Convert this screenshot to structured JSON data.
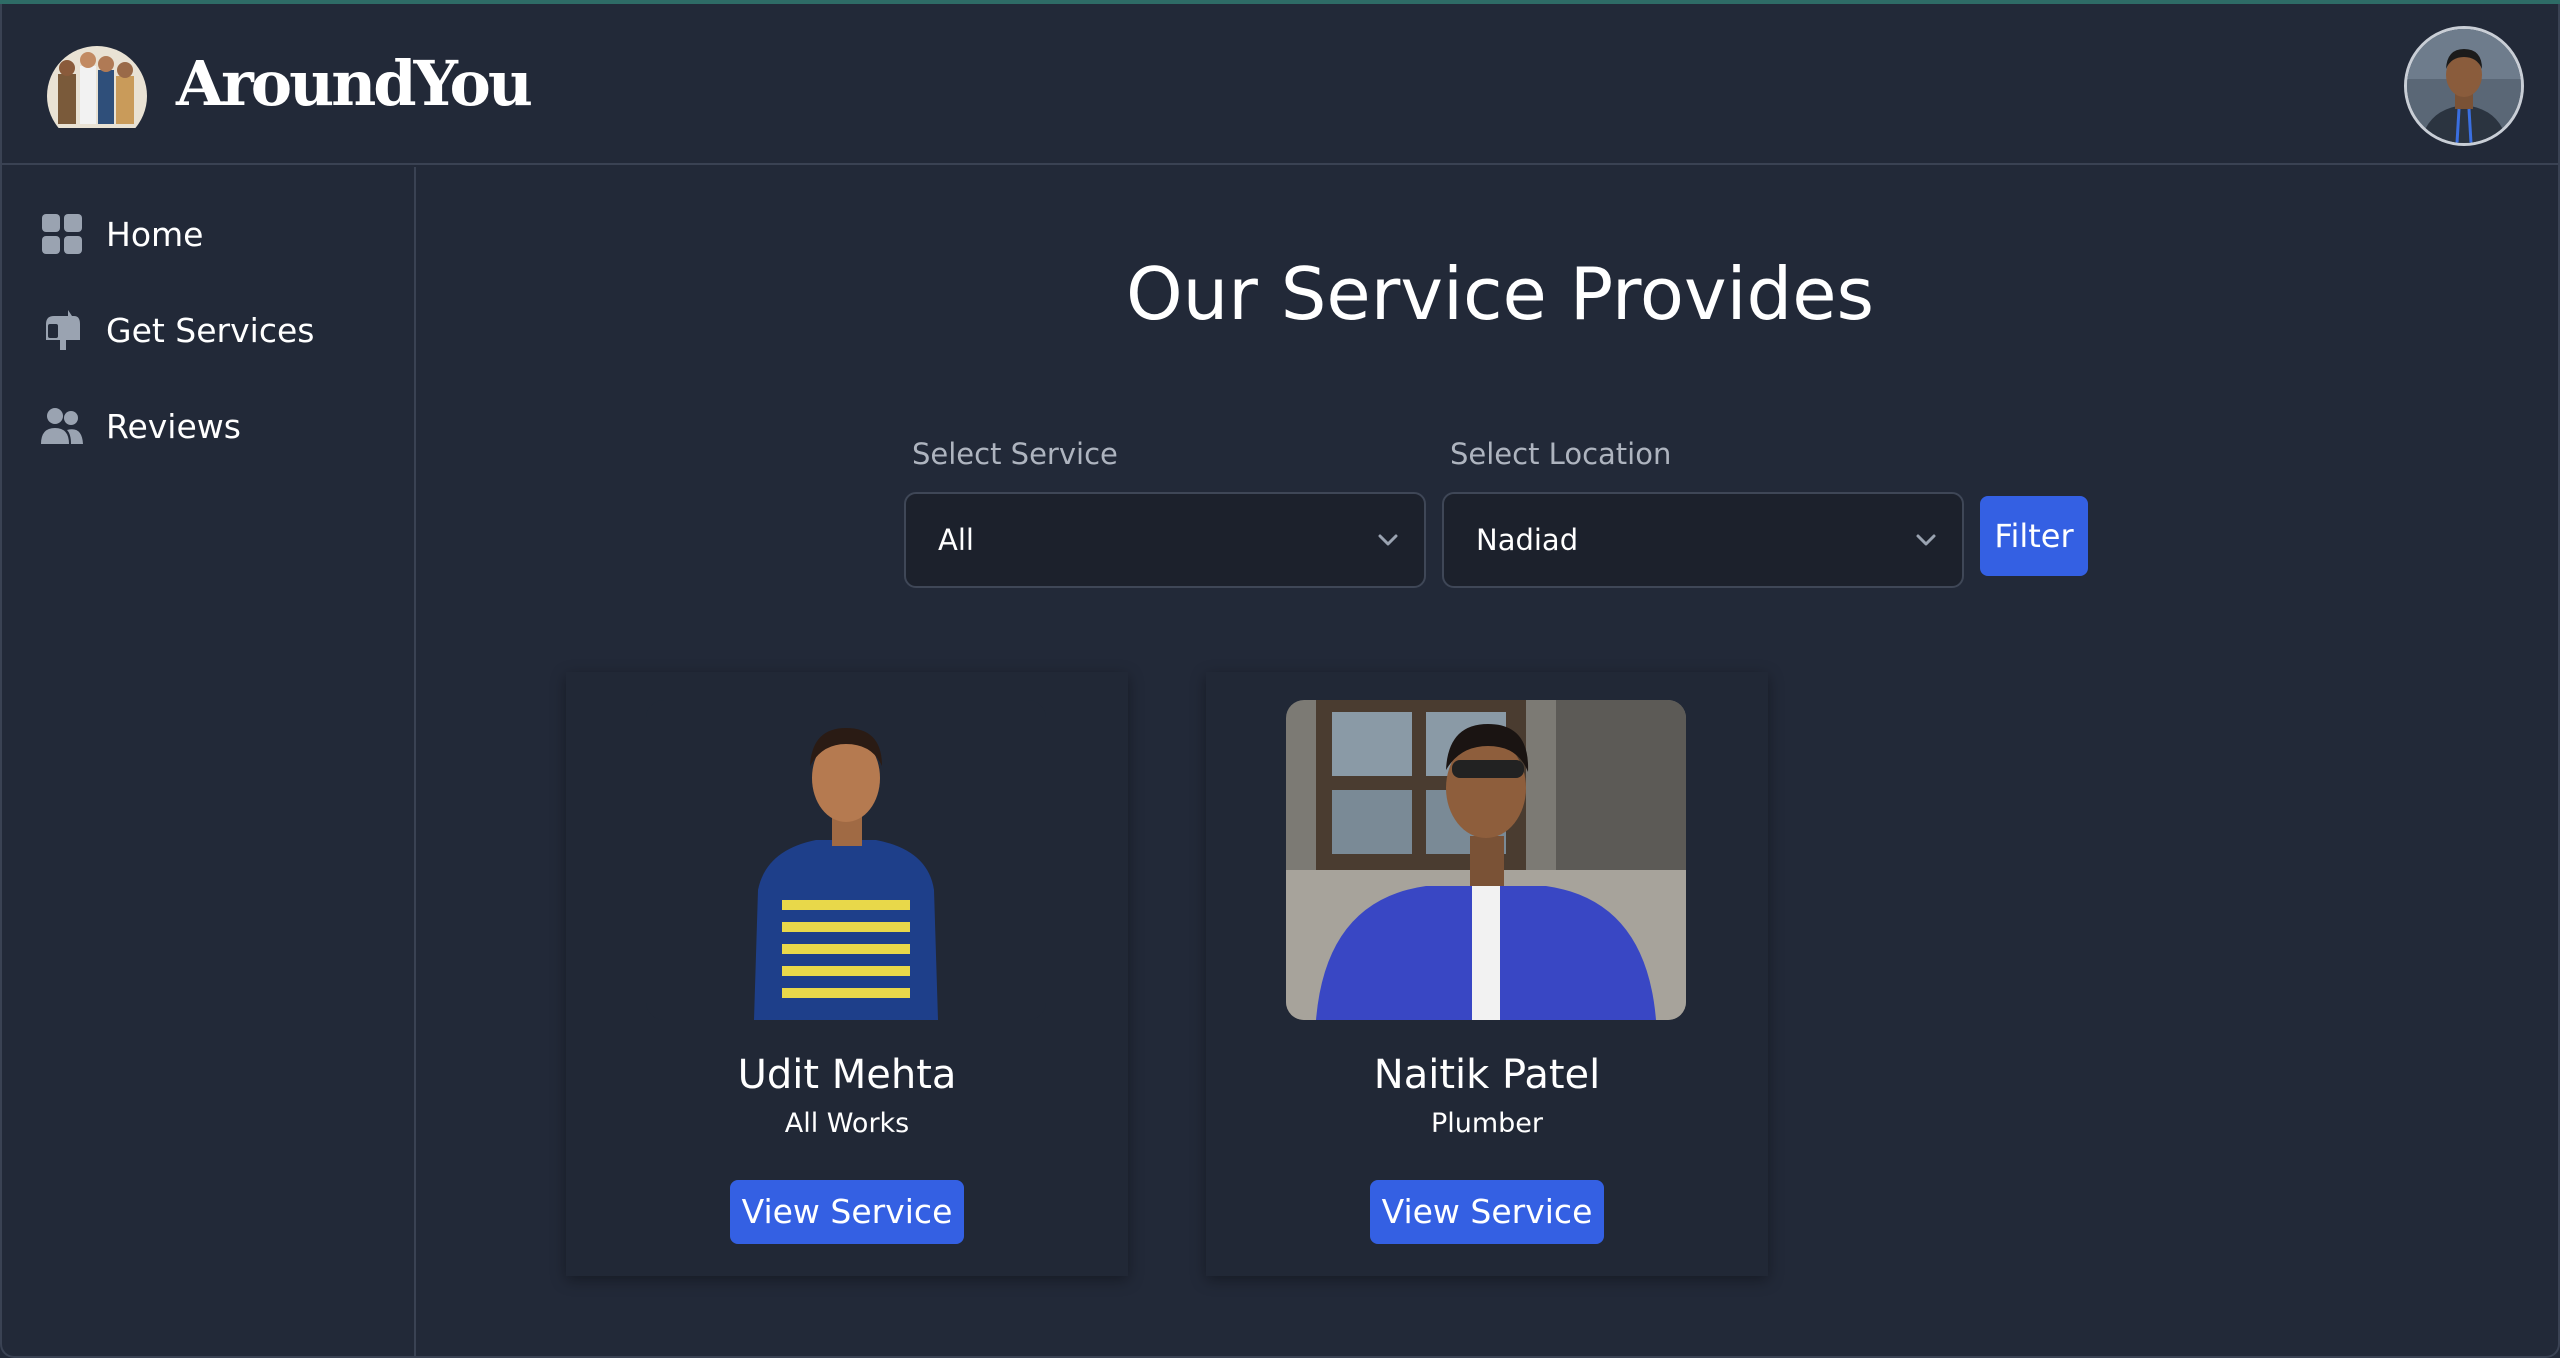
{
  "app": {
    "brand": "AroundYou"
  },
  "sidebar": {
    "items": [
      {
        "label": "Home",
        "icon": "grid-icon"
      },
      {
        "label": "Get Services",
        "icon": "mailbox-icon"
      },
      {
        "label": "Reviews",
        "icon": "users-icon"
      }
    ]
  },
  "main": {
    "title": "Our Service Provides",
    "filters": {
      "service_label": "Select Service",
      "service_value": "All",
      "location_label": "Select Location",
      "location_value": "Nadiad",
      "filter_button": "Filter"
    },
    "providers": [
      {
        "name": "Udit Mehta",
        "role": "All Works",
        "button": "View Service"
      },
      {
        "name": "Naitik Patel",
        "role": "Plumber",
        "button": "View Service"
      }
    ]
  },
  "colors": {
    "background": "#222938",
    "accent": "#3460e3",
    "border": "#3a4253"
  }
}
